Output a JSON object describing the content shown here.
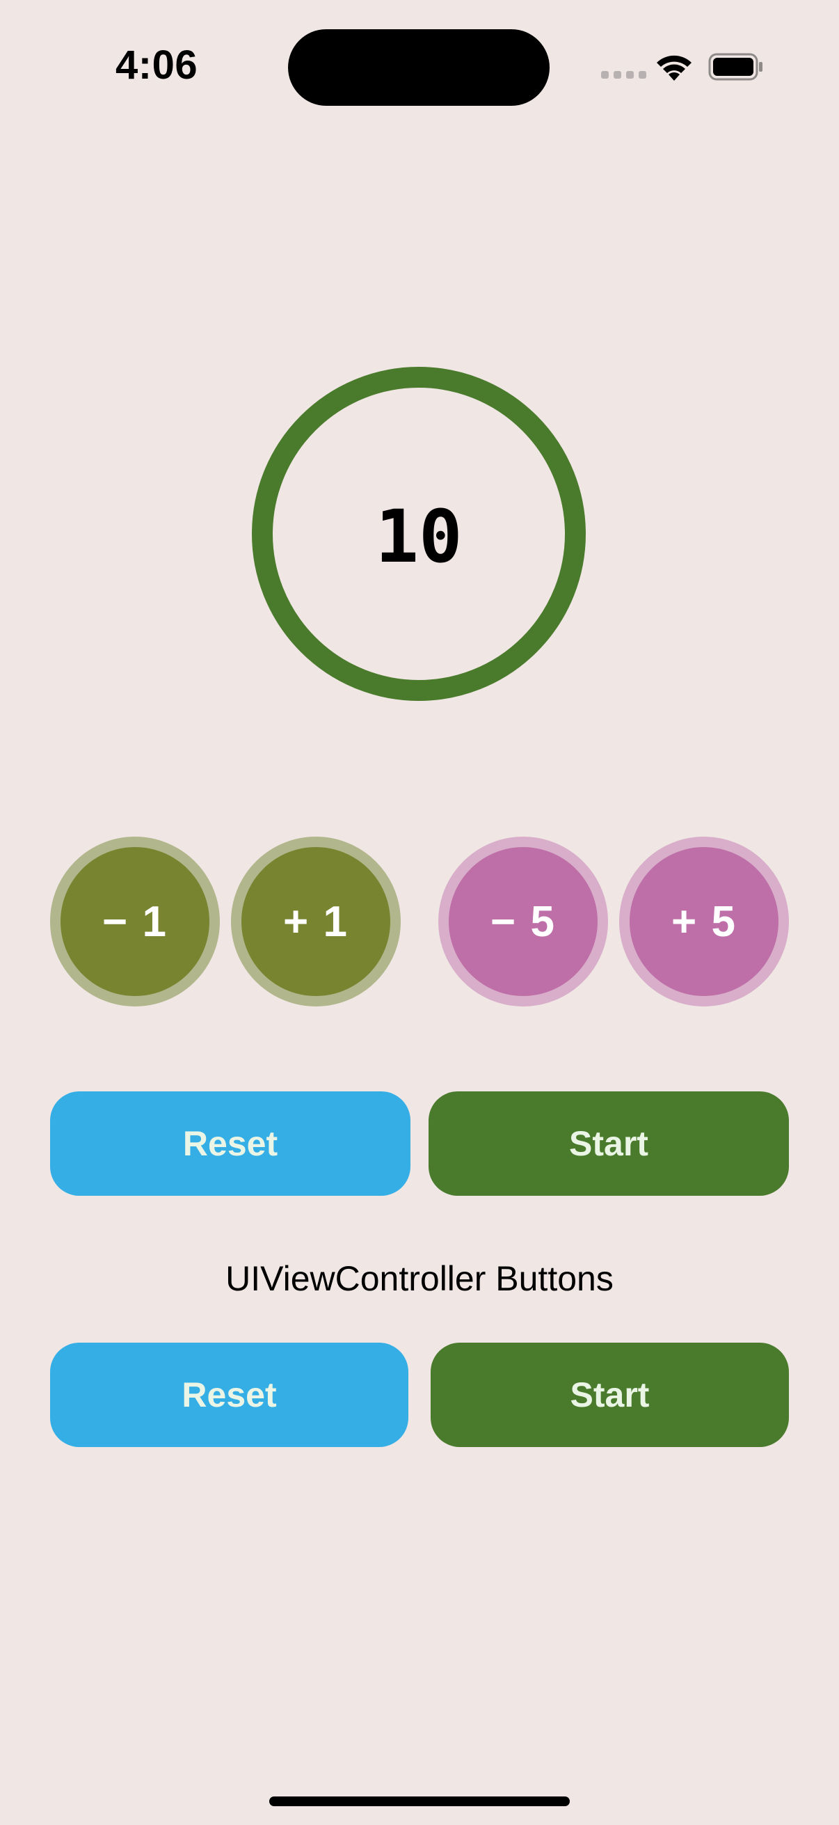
{
  "status_bar": {
    "time": "4:06",
    "signal_icon": "cellular-signal-icon",
    "wifi_icon": "wifi-icon",
    "battery_icon": "battery-icon"
  },
  "counter": {
    "value": "10",
    "ring_color": "#4A7A2B"
  },
  "step_buttons": {
    "minus_one": "− 1",
    "plus_one": "+ 1",
    "minus_five": "− 5",
    "plus_five": "+ 5",
    "olive_color": "#788430",
    "pink_color": "#BE6FA8"
  },
  "swiftui_buttons": {
    "reset_label": "Reset",
    "start_label": "Start"
  },
  "section": {
    "title": "UIViewController Buttons"
  },
  "uikit_buttons": {
    "reset_label": "Reset",
    "start_label": "Start"
  },
  "colors": {
    "background": "#F0E7E4",
    "reset_blue": "#35AEE6",
    "start_green": "#4A7A2B"
  }
}
